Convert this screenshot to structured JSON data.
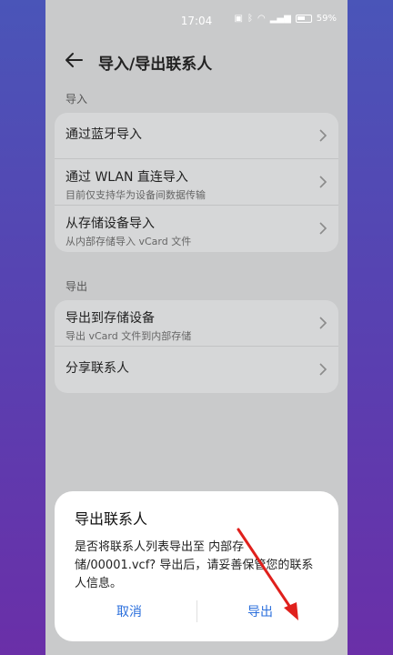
{
  "status": {
    "time": "17:04",
    "battery": "59%"
  },
  "header": {
    "title": "导入/导出联系人"
  },
  "import": {
    "label": "导入",
    "items": [
      {
        "title": "通过蓝牙导入",
        "subtitle": ""
      },
      {
        "title": "通过 WLAN 直连导入",
        "subtitle": "目前仅支持华为设备间数据传输"
      },
      {
        "title": "从存储设备导入",
        "subtitle": "从内部存储导入 vCard 文件"
      }
    ]
  },
  "export": {
    "label": "导出",
    "items": [
      {
        "title": "导出到存储设备",
        "subtitle": "导出 vCard 文件到内部存储"
      },
      {
        "title": "分享联系人",
        "subtitle": ""
      }
    ]
  },
  "dialog": {
    "title": "导出联系人",
    "message": "是否将联系人列表导出至 内部存储/00001.vcf? 导出后，请妥善保管您的联系人信息。",
    "cancel": "取消",
    "confirm": "导出"
  },
  "colors": {
    "accent": "#2b6fdc",
    "annotation": "#e0201c"
  },
  "icons": {
    "back": "arrow-left-icon",
    "chevron": "chevron-right-icon"
  }
}
